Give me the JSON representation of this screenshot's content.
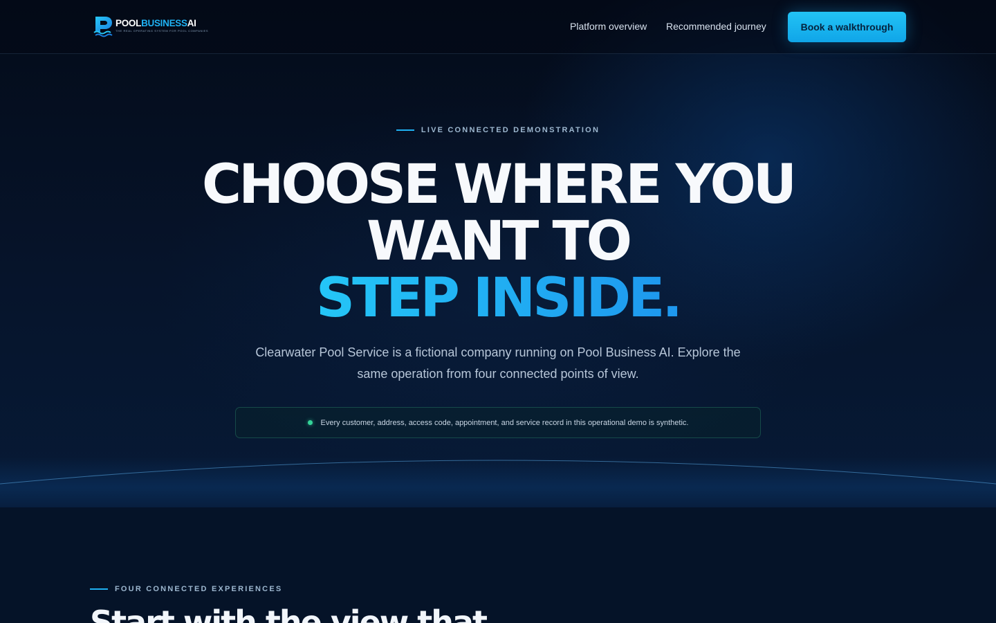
{
  "brand": {
    "word_pool": "POOL",
    "word_business": "BUSINESS",
    "word_ai": "AI",
    "tagline": "THE REAL OPERATING SYSTEM FOR POOL COMPANIES",
    "mark_letter": "P"
  },
  "nav": {
    "links": [
      "Platform overview",
      "Recommended journey"
    ],
    "cta_label": "Book a walkthrough"
  },
  "hero": {
    "eyebrow": "LIVE CONNECTED DEMONSTRATION",
    "headline_line1": "CHOOSE WHERE YOU",
    "headline_line2": "WANT TO",
    "headline_accent": "STEP INSIDE.",
    "subtitle": "Clearwater Pool Service is a fictional company running on Pool Business AI. Explore the same operation from four connected points of view.",
    "notice": "Every customer, address, access code, appointment, and service record in this operational demo is synthetic."
  },
  "section": {
    "eyebrow": "FOUR CONNECTED EXPERIENCES",
    "title": "Start with the view that"
  },
  "colors": {
    "accent": "#1fb1f2",
    "background": "#051226",
    "notice_dot": "#34d399"
  }
}
